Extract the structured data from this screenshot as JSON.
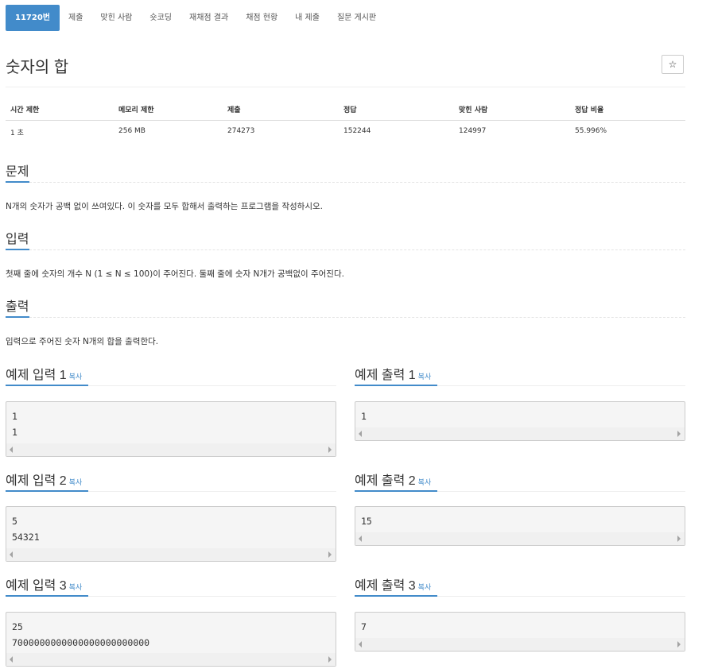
{
  "nav": {
    "items": [
      "11720번",
      "제출",
      "맞힌 사람",
      "숏코딩",
      "재채점 결과",
      "채점 현황",
      "내 제출",
      "질문 게시판"
    ]
  },
  "problem": {
    "title": "숫자의 합",
    "star_icon": "star-icon",
    "star_glyph": "☆"
  },
  "info_table": {
    "headers": [
      "시간 제한",
      "메모리 제한",
      "제출",
      "정답",
      "맞힌 사람",
      "정답 비율"
    ],
    "values": [
      "1 초",
      "256 MB",
      "274273",
      "152244",
      "124997",
      "55.996%"
    ]
  },
  "sections": {
    "problem": {
      "title": "문제",
      "text": "N개의 숫자가 공백 없이 쓰여있다. 이 숫자를 모두 합해서 출력하는 프로그램을 작성하시오."
    },
    "input": {
      "title": "입력",
      "text": "첫째 줄에 숫자의 개수 N (1 ≤ N ≤ 100)이 주어진다. 둘째 줄에 숫자 N개가 공백없이 주어진다."
    },
    "output": {
      "title": "출력",
      "text": "입력으로 주어진 숫자 N개의 합을 출력한다."
    }
  },
  "copy_label": "복사",
  "examples": [
    {
      "input_title": "예제 입력 1",
      "input_lines": [
        "1",
        "1"
      ],
      "output_title": "예제 출력 1",
      "output_lines": [
        "1"
      ]
    },
    {
      "input_title": "예제 입력 2",
      "input_lines": [
        "5",
        "54321"
      ],
      "output_title": "예제 출력 2",
      "output_lines": [
        "15"
      ]
    },
    {
      "input_title": "예제 입력 3",
      "input_lines": [
        "25",
        "7000000000000000000000000"
      ],
      "output_title": "예제 출력 3",
      "output_lines": [
        "7"
      ]
    }
  ],
  "colors": {
    "accent": "#428bca",
    "border": "#cccccc",
    "pre_bg": "#f5f5f5"
  }
}
